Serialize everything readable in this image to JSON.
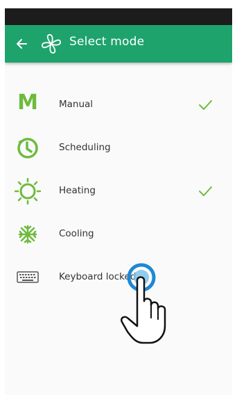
{
  "appbar": {
    "title": "Select mode",
    "back_icon": "arrow-left-icon",
    "app_icon": "fan-icon",
    "color": "#1ea36d"
  },
  "modes": [
    {
      "label": "Manual",
      "icon": "manual-m-icon",
      "checked": true
    },
    {
      "label": "Scheduling",
      "icon": "clock-icon",
      "checked": false
    },
    {
      "label": "Heating",
      "icon": "sun-icon",
      "checked": true
    },
    {
      "label": "Cooling",
      "icon": "snowflake-icon",
      "checked": false
    },
    {
      "label": "Keyboard locked",
      "icon": "keyboard-icon",
      "checked": false
    }
  ],
  "colors": {
    "accent": "#6dbb3c",
    "statusbar": "#1c1c1c",
    "tap_indicator": "#1e88d4"
  },
  "overlay": {
    "icon": "tap-hand-icon"
  }
}
